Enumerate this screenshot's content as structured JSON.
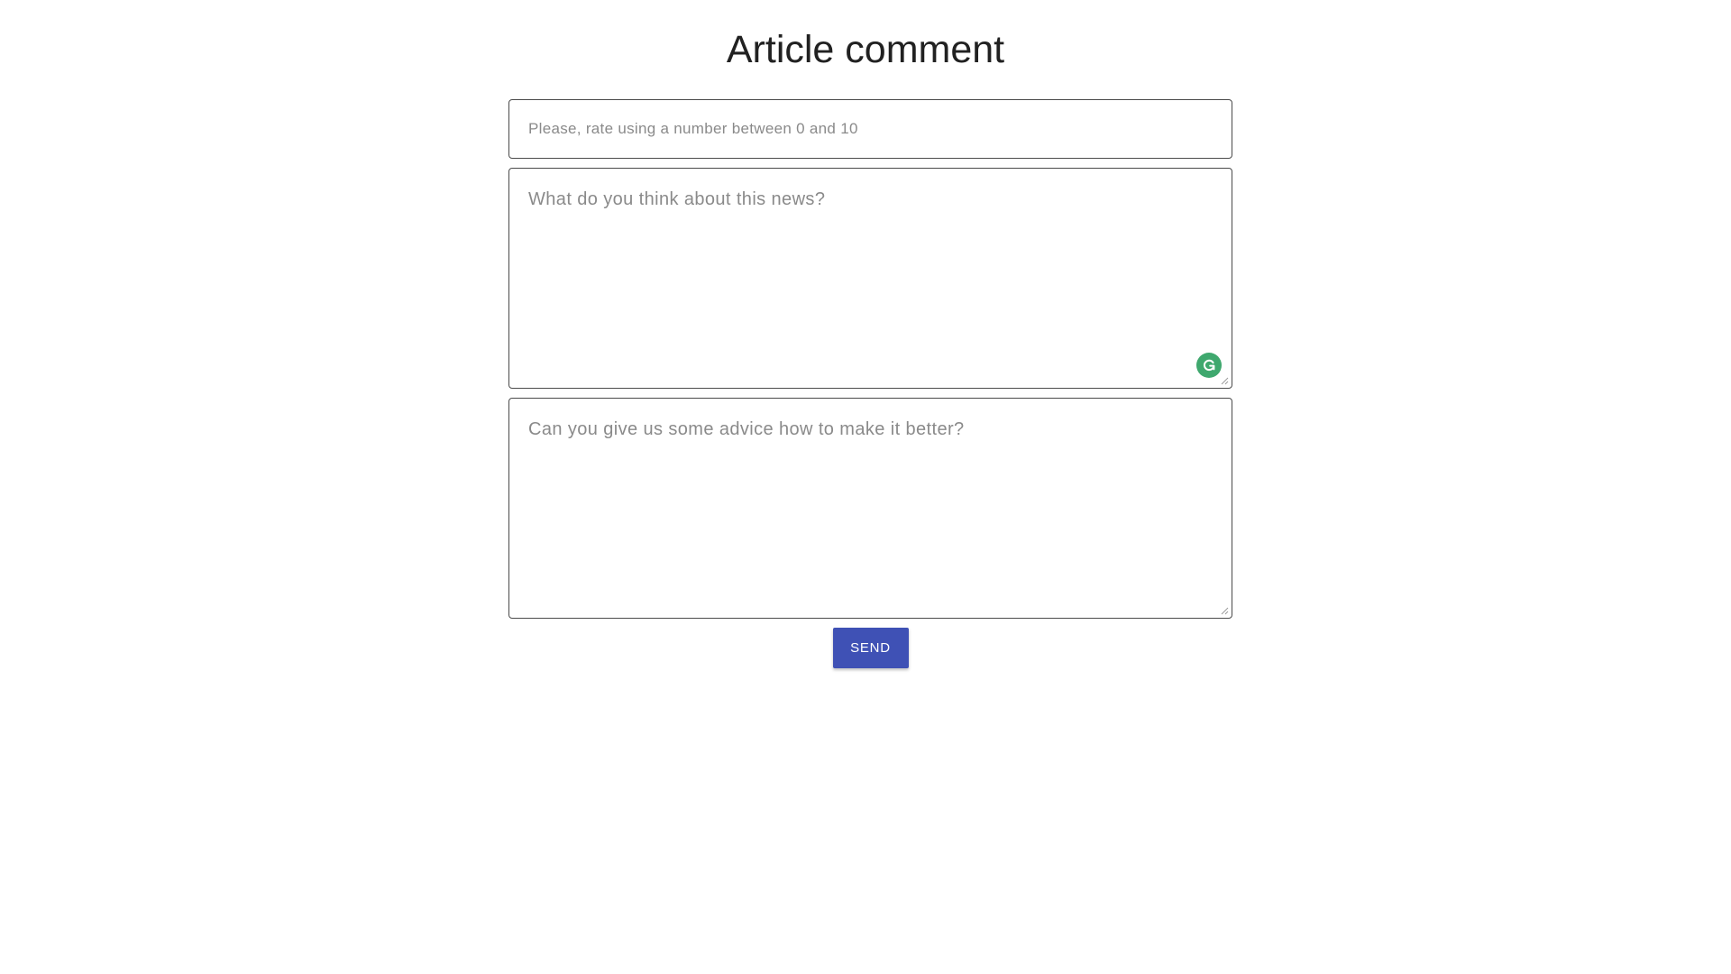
{
  "page": {
    "title": "Article comment"
  },
  "form": {
    "rating": {
      "value": "",
      "placeholder": "Please, rate using a number between 0 and 10"
    },
    "opinion": {
      "value": "",
      "placeholder": "What do you think about this news?"
    },
    "advice": {
      "value": "",
      "placeholder": "Can you give us some advice how to make it better?"
    },
    "send_label": "SEND"
  },
  "icons": {
    "grammarly": "grammarly-icon",
    "resize": "resize-handle-icon"
  },
  "colors": {
    "button": "#3f51b5",
    "grammarly": "#3fa86e"
  }
}
